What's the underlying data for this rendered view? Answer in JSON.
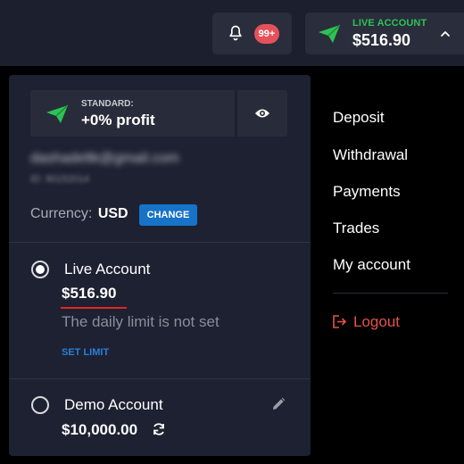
{
  "header": {
    "notifications_badge": "99+",
    "account_type_label": "LIVE ACCOUNT",
    "account_balance": "$516.90"
  },
  "panel": {
    "plan_label": "STANDARD:",
    "plan_value": "+0% profit",
    "email": "dashadeltk@gmail.com",
    "user_id": "ID: 90152014",
    "currency_label": "Currency:",
    "currency_value": "USD",
    "change_button": "CHANGE",
    "accounts": {
      "live": {
        "name": "Live Account",
        "balance": "$516.90",
        "limit_text": "The daily limit is not set",
        "set_limit": "SET LIMIT",
        "selected": true
      },
      "demo": {
        "name": "Demo Account",
        "balance": "$10,000.00",
        "selected": false
      }
    }
  },
  "menu": {
    "items": [
      "Deposit",
      "Withdrawal",
      "Payments",
      "Trades",
      "My account"
    ],
    "logout": "Logout"
  },
  "colors": {
    "accent_green": "#2ec255",
    "accent_blue": "#1773c8",
    "badge_red": "#e5515a",
    "logout_red": "#e5524a",
    "panel_bg": "#1d2131"
  },
  "icons": [
    "bell-icon",
    "paper-plane-icon",
    "chevron-up-icon",
    "eye-icon",
    "pencil-icon",
    "refresh-icon",
    "logout-icon"
  ]
}
